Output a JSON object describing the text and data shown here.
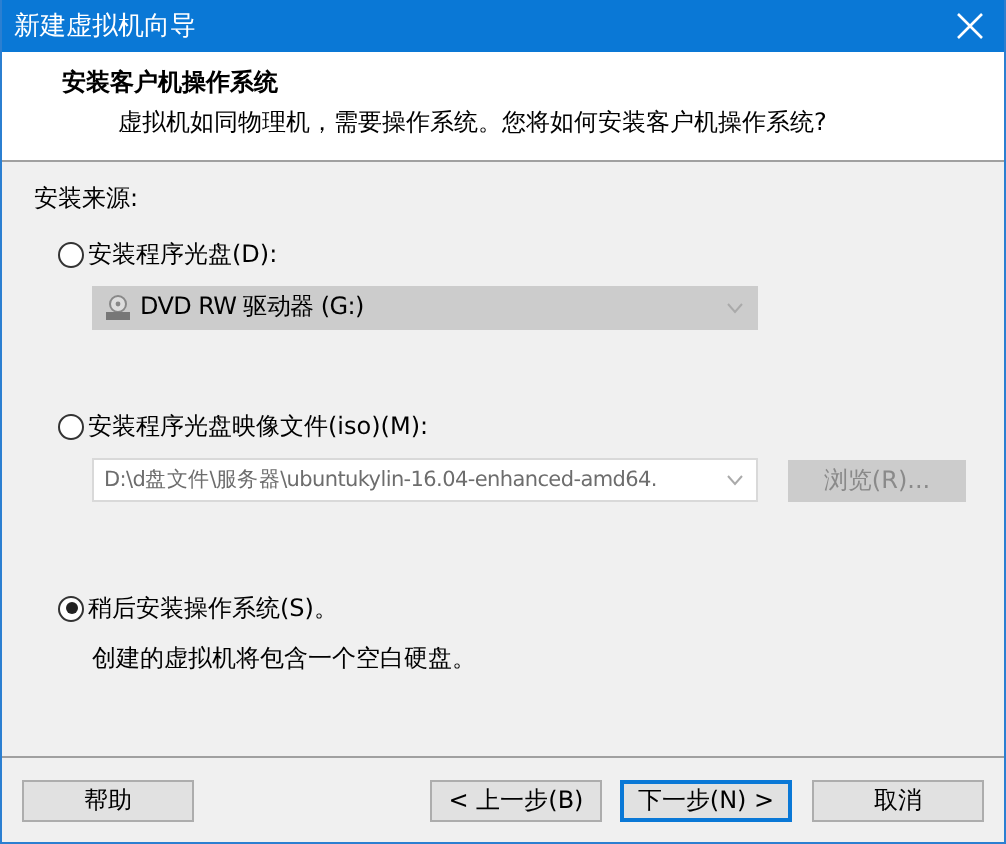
{
  "window": {
    "title": "新建虚拟机向导"
  },
  "header": {
    "title": "安装客户机操作系统",
    "subtitle": "虚拟机如同物理机，需要操作系统。您将如何安装客户机操作系统?"
  },
  "source_label": "安装来源:",
  "options": [
    {
      "label": "安装程序光盘(D):",
      "selected": false,
      "dropdown": {
        "kind": "list",
        "value": "DVD RW 驱动器 (G:)",
        "disabled": true
      }
    },
    {
      "label": "安装程序光盘映像文件(iso)(M):",
      "selected": false,
      "dropdown": {
        "kind": "editable",
        "value": "D:\\d盘文件\\服务器\\ubuntukylin-16.04-enhanced-amd64.",
        "disabled": true
      },
      "browse_button": {
        "label": "浏览(R)...",
        "disabled": true
      }
    },
    {
      "label": "稍后安装操作系统(S)。",
      "selected": true,
      "note": "创建的虚拟机将包含一个空白硬盘。"
    }
  ],
  "help_button": {
    "label": "帮助",
    "focused": false
  },
  "buttons": [
    {
      "label": "< 上一步(B)",
      "focused": false
    },
    {
      "label": "下一步(N) >",
      "focused": true
    },
    {
      "label": "取消",
      "focused": false
    }
  ]
}
